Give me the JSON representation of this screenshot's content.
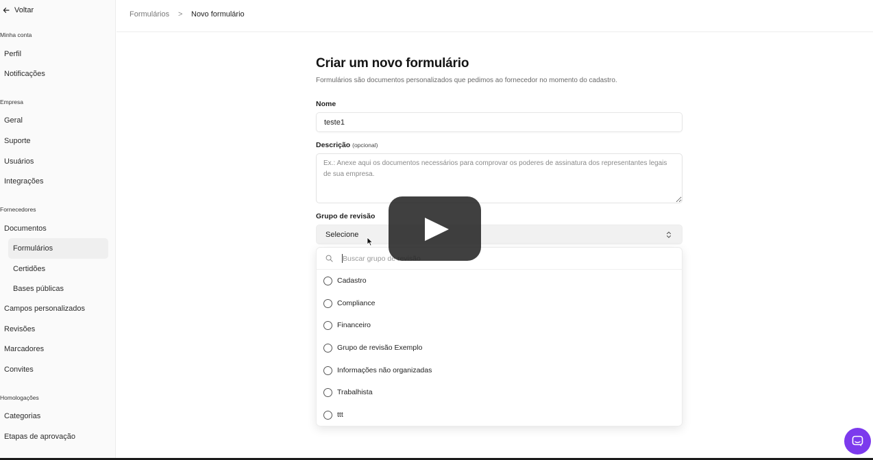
{
  "sidebar": {
    "back_label": "Voltar",
    "sections": [
      {
        "title": "Minha conta",
        "items": [
          "Perfil",
          "Notificações"
        ]
      },
      {
        "title": "Empresa",
        "items": [
          "Geral",
          "Suporte",
          "Usuários",
          "Integrações"
        ]
      },
      {
        "title": "Fornecedores",
        "items": [
          "Documentos",
          "Formulários",
          "Certidões",
          "Bases públicas",
          "Campos personalizados",
          "Revisões",
          "Marcadores",
          "Convites"
        ]
      },
      {
        "title": "Homologações",
        "items": [
          "Categorias",
          "Etapas de aprovação"
        ]
      }
    ],
    "active_item": "Formulários"
  },
  "breadcrumb": {
    "parent": "Formulários",
    "separator": ">",
    "current": "Novo formulário"
  },
  "form": {
    "title": "Criar um novo formulário",
    "subtitle": "Formulários são documentos personalizados que pedimos ao fornecedor no momento do cadastro.",
    "name_label": "Nome",
    "name_value": "teste1",
    "description_label": "Descrição",
    "description_optional": "(opcional)",
    "description_placeholder": "Ex.: Anexe aqui os documentos necessários para comprovar os poderes de assinatura dos representantes legais de sua empresa.",
    "group_label": "Grupo de revisão",
    "group_selected": "Selecione"
  },
  "dropdown": {
    "search_placeholder": "Buscar grupo de revisão",
    "options": [
      "Cadastro",
      "Compliance",
      "Financeiro",
      "Grupo de revisão Exemplo",
      "Informações não organizadas",
      "Trabalhista",
      "ttt"
    ]
  },
  "colors": {
    "accent": "#7c3aed",
    "active_bg": "#efefef",
    "select_bg": "#f1f1f1"
  },
  "icons": {
    "back": "arrow-left-icon",
    "search": "search-icon",
    "select": "chevron-up-down-icon",
    "play": "play-icon",
    "chat": "chat-icon"
  }
}
